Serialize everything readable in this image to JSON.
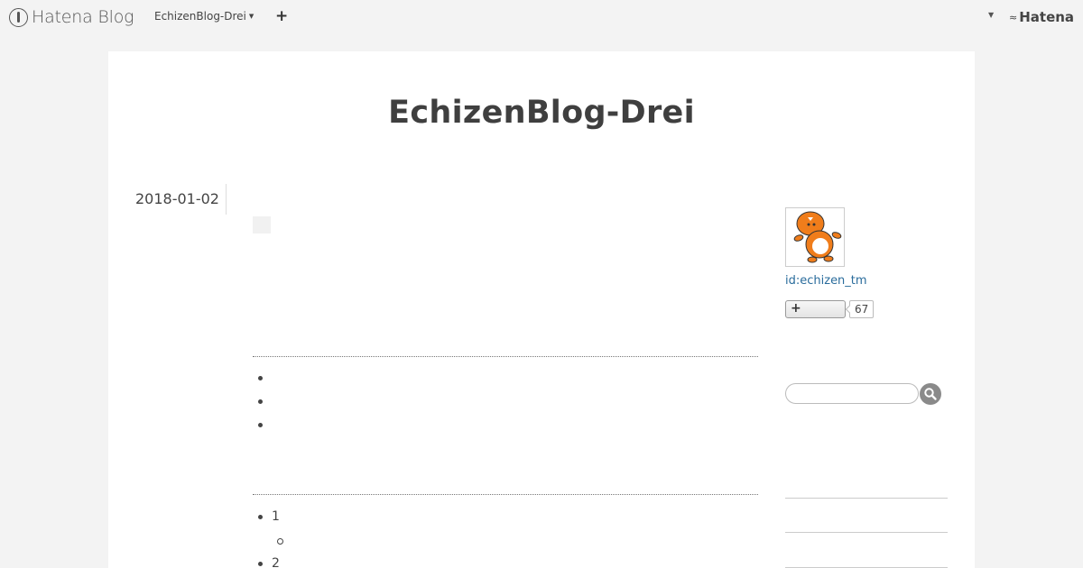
{
  "topbar": {
    "brand": "Hatena Blog",
    "blog_switcher": "EchizenBlog-Drei",
    "add_symbol": "+",
    "account_logo": "Hatena"
  },
  "blog": {
    "title": "EchizenBlog-Drei"
  },
  "entry": {
    "date": "2018-01-02",
    "list1": [
      "",
      "",
      ""
    ],
    "list2": [
      "1",
      "",
      "2"
    ]
  },
  "sidebar": {
    "profile_id": "id:echizen_tm",
    "subscribe_symbol": "+",
    "subscriber_count": "67",
    "search_placeholder": ""
  },
  "colors": {
    "background": "#f3f3f3",
    "card": "#ffffff",
    "link": "#2a6c9c",
    "avatar_orange": "#f07d1b"
  },
  "icons": [
    "hatena-blog-logo-icon",
    "caret-down-icon",
    "plus-icon",
    "hatena-logo-icon",
    "search-icon"
  ]
}
